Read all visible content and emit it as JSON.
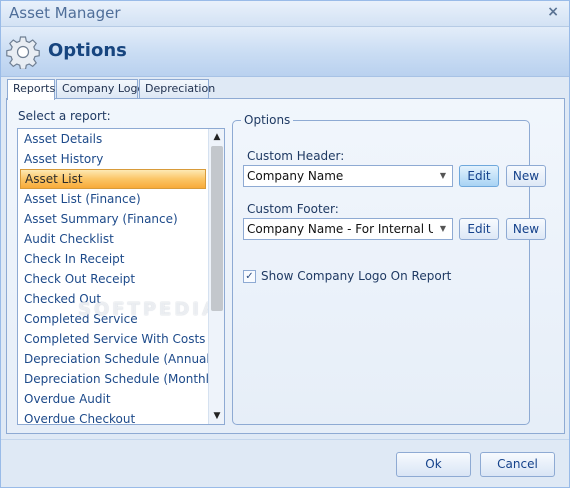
{
  "window": {
    "title": "Asset Manager",
    "close_glyph": "×"
  },
  "banner": {
    "icon": "gear-icon",
    "title": "Options"
  },
  "tabs": [
    {
      "label": "Reports",
      "active": true
    },
    {
      "label": "Company Logo",
      "active": false
    },
    {
      "label": "Depreciation",
      "active": false
    }
  ],
  "reports": {
    "select_label": "Select a report:",
    "items": [
      "Asset Details",
      "Asset History",
      "Asset List",
      "Asset List (Finance)",
      "Asset Summary (Finance)",
      "Audit Checklist",
      "Check In Receipt",
      "Check Out Receipt",
      "Checked Out",
      "Completed Service",
      "Completed Service With Costs",
      "Depreciation Schedule (Annual)",
      "Depreciation Schedule (Monthly)",
      "Overdue Audit",
      "Overdue Checkout"
    ],
    "selected": "Asset List",
    "scroll_up": "▲",
    "scroll_down": "▼",
    "watermark": "SOFTPEDIA"
  },
  "options": {
    "group_title": "Options",
    "custom_header": {
      "label": "Custom Header:",
      "value": "Company Name",
      "edit_label": "Edit",
      "new_label": "New"
    },
    "custom_footer": {
      "label": "Custom Footer:",
      "value": "Company Name - For Internal Use Only",
      "edit_label": "Edit",
      "new_label": "New"
    },
    "show_logo": {
      "label": "Show Company Logo On Report",
      "checked": true,
      "check_glyph": "✓"
    }
  },
  "footer": {
    "ok_label": "Ok",
    "cancel_label": "Cancel"
  },
  "colors": {
    "accent": "#15428b",
    "selection": "#f8aa3a",
    "border": "#8eaad3"
  }
}
